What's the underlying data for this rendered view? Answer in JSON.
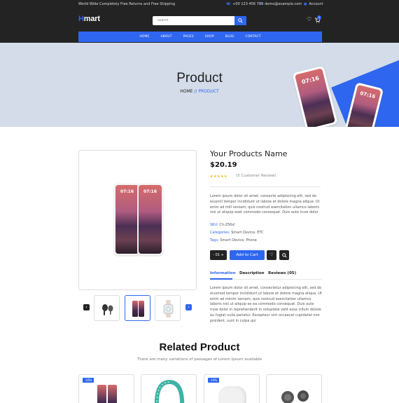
{
  "topbar": {
    "promo": "World Wide Completely Free Returns and Free Shipping",
    "phone": "+00 123 456 789",
    "email": "demo@example.com",
    "account": "Account",
    "cart_count": "0"
  },
  "brand": {
    "logo_h": "H",
    "logo_rest": "mart"
  },
  "search": {
    "placeholder": "Search"
  },
  "nav": {
    "items": [
      "HOME",
      "ABOUT",
      "PAGES",
      "SHOP",
      "BLOG",
      "CONTACT"
    ]
  },
  "hero": {
    "title": "Product",
    "breadcrumb_home": "HOME",
    "breadcrumb_sep": " // ",
    "breadcrumb_current": "PRODUCT",
    "phone_time": "07:16"
  },
  "product": {
    "name": "Your Products Name",
    "price": "$20.19",
    "rating": 5,
    "review_text": "(5 Customer Review)",
    "description": "Lorem ipsum dolor sit amet, consecte adipisicing elit, sed do eiusmil tempor incididunt ut labore et dolore magna aliqua. Ut enim ad mill veniam, quis nostrud exercitation ullamco laboris nisi ut aliquip exet commodo consequat. Duis aute irure dolor",
    "sku_label": "SKU:",
    "sku_value": "Ch-256xl",
    "categories_label": "Categories:",
    "categories_value": "Smart Device, ETC",
    "tags_label": "Tags:",
    "tags_value": "Smart Device, Phone",
    "qty_minus": "-",
    "qty_value": "01",
    "qty_plus": "+",
    "add_to_cart": "Add to Cart"
  },
  "tabs": {
    "information": "Information",
    "description": "Description",
    "reviews": "Reviews (05)",
    "content": "Lorem ipsum dolor sit amet, consectetur adipisicing elit, sed do eiusmod tempor incididunt ut labore et dolore magna aliqua. Ut enim ad minim veniam, quis nostrud exercitation ullamco laboris nisi ut aliquip ex ea commodo consequat. Duis aute irure dolor in reprehenderit in voluptate velit esse cillum dolore eu fugiat nulla pariatur. Excepteur sint occaecat cupidatat non proident, sunt in culpa qui"
  },
  "related": {
    "title": "Related Product",
    "subtitle": "There are many variations of passages of Lorem Ipsum available",
    "discount_1": "-10%",
    "discount_3": "-10%"
  },
  "colors": {
    "accent": "#2f66ef",
    "dark": "#232323",
    "hero_bg": "#d3dce8",
    "star": "#f5b301"
  }
}
